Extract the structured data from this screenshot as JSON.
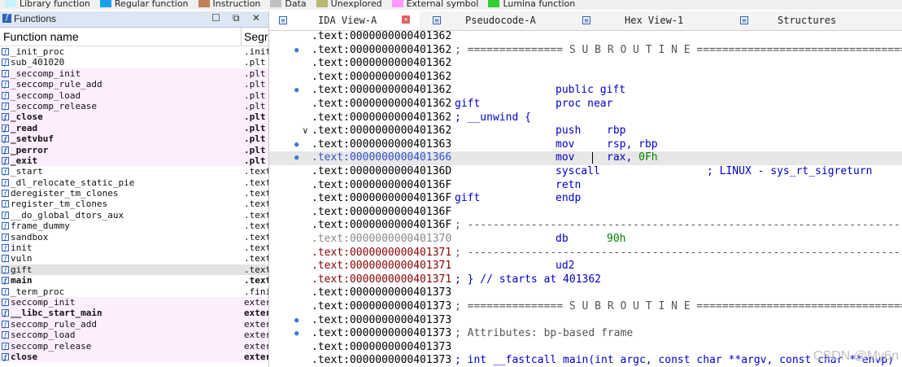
{
  "legend": [
    {
      "label": "Library function",
      "color": "#c8f2ff"
    },
    {
      "label": "Regular function",
      "color": "#1aa0ef"
    },
    {
      "label": "Instruction",
      "color": "#c0805a"
    },
    {
      "label": "Data",
      "color": "#c0c0c0"
    },
    {
      "label": "Unexplored",
      "color": "#b8b870"
    },
    {
      "label": "External symbol",
      "color": "#ff99ff"
    },
    {
      "label": "Lumina function",
      "color": "#33cc33"
    }
  ],
  "functions_panel": {
    "title": "Functions",
    "buttons": "☐ ⧉ ✕",
    "col_name": "Function name",
    "col_segment": "Segr",
    "rows": [
      {
        "name": "_init_proc",
        "seg": ".init",
        "style": ""
      },
      {
        "name": "sub_401020",
        "seg": ".plt",
        "style": ""
      },
      {
        "name": "_seccomp_init",
        "seg": ".plt",
        "style": "lib"
      },
      {
        "name": "_seccomp_rule_add",
        "seg": ".plt",
        "style": "lib"
      },
      {
        "name": "_seccomp_load",
        "seg": ".plt",
        "style": "lib"
      },
      {
        "name": "_seccomp_release",
        "seg": ".plt",
        "style": "lib"
      },
      {
        "name": "_close",
        "seg": ".plt",
        "style": "lib bold"
      },
      {
        "name": "_read",
        "seg": ".plt",
        "style": "lib bold"
      },
      {
        "name": "_setvbuf",
        "seg": ".plt",
        "style": "lib bold"
      },
      {
        "name": "_perror",
        "seg": ".plt",
        "style": "lib bold"
      },
      {
        "name": "_exit",
        "seg": ".plt",
        "style": "lib bold"
      },
      {
        "name": "_start",
        "seg": ".text",
        "style": ""
      },
      {
        "name": "_dl_relocate_static_pie",
        "seg": ".text",
        "style": ""
      },
      {
        "name": "deregister_tm_clones",
        "seg": ".text",
        "style": ""
      },
      {
        "name": "register_tm_clones",
        "seg": ".text",
        "style": ""
      },
      {
        "name": "__do_global_dtors_aux",
        "seg": ".text",
        "style": ""
      },
      {
        "name": "frame_dummy",
        "seg": ".text",
        "style": ""
      },
      {
        "name": "sandbox",
        "seg": ".text",
        "style": ""
      },
      {
        "name": "init",
        "seg": ".text",
        "style": ""
      },
      {
        "name": "vuln",
        "seg": ".text",
        "style": ""
      },
      {
        "name": "gift",
        "seg": ".text",
        "style": "sel"
      },
      {
        "name": "main",
        "seg": ".text",
        "style": "bold"
      },
      {
        "name": "_term_proc",
        "seg": ".fini",
        "style": ""
      },
      {
        "name": "seccomp_init",
        "seg": "exter",
        "style": "lib"
      },
      {
        "name": "__libc_start_main",
        "seg": "exter",
        "style": "lib bold"
      },
      {
        "name": "seccomp_rule_add",
        "seg": "exter",
        "style": "lib"
      },
      {
        "name": "seccomp_load",
        "seg": "exter",
        "style": "lib"
      },
      {
        "name": "seccomp_release",
        "seg": "exter",
        "style": "lib"
      },
      {
        "name": "close",
        "seg": "exter",
        "style": "lib bold"
      }
    ]
  },
  "tabs": [
    {
      "label": "IDA View-A",
      "active": true
    },
    {
      "label": "Pseudocode-A",
      "active": false
    },
    {
      "label": "Hex View-1",
      "active": false
    },
    {
      "label": "Structures",
      "active": false
    }
  ],
  "disasm": [
    {
      "addr": ".text:0000000000401362",
      "addr_style": "",
      "dot": false
    },
    {
      "addr": ".text:0000000000401362",
      "addr_style": "",
      "dot": true,
      "cmt_line": "; =============== S U B R O U T I N E ======================================="
    },
    {
      "addr": ".text:0000000000401362",
      "addr_style": "",
      "dot": false
    },
    {
      "addr": ".text:0000000000401362",
      "addr_style": "",
      "dot": false
    },
    {
      "addr": ".text:0000000000401362",
      "addr_style": "",
      "dot": true,
      "mnem": "public gift"
    },
    {
      "addr": ".text:0000000000401362",
      "addr_style": "",
      "dot": false,
      "label": "gift",
      "mnem": "proc near"
    },
    {
      "addr": ".text:0000000000401362",
      "addr_style": "",
      "dot": false,
      "label": "; __unwind {"
    },
    {
      "addr": ".text:0000000000401362",
      "addr_style": "",
      "dot": false,
      "chev": "∨",
      "mnem": "push",
      "op": "rbp"
    },
    {
      "addr": ".text:0000000000401363",
      "addr_style": "",
      "dot": true,
      "mnem": "mov",
      "op": "rsp, rbp"
    },
    {
      "addr": ".text:0000000000401366",
      "addr_style": "blue",
      "dot": true,
      "hl": true,
      "mnem": "mov",
      "op": "rax, ",
      "num": "0Fh",
      "cursor": true
    },
    {
      "addr": ".text:000000000040136D",
      "addr_style": "",
      "dot": false,
      "mnem": "syscall",
      "cmt_right": "; LINUX - sys_rt_sigreturn"
    },
    {
      "addr": ".text:000000000040136F",
      "addr_style": "",
      "dot": false,
      "mnem": "retn"
    },
    {
      "addr": ".text:000000000040136F",
      "addr_style": "",
      "dot": false,
      "label": "gift",
      "mnem": "endp"
    },
    {
      "addr": ".text:000000000040136F",
      "addr_style": "",
      "dot": false
    },
    {
      "addr": ".text:000000000040136F",
      "addr_style": "",
      "dot": false,
      "cmt_line": "; ---------------------------------------------------------------------------"
    },
    {
      "addr": ".text:0000000000401370",
      "addr_style": "grey",
      "dot": false,
      "mnem": "db",
      "op": "",
      "num": "90h"
    },
    {
      "addr": ".text:0000000000401371",
      "addr_style": "red",
      "dot": false,
      "cmt_line": "; ---------------------------------------------------------------------------"
    },
    {
      "addr": ".text:0000000000401371",
      "addr_style": "red",
      "dot": false,
      "mnem": "ud2"
    },
    {
      "addr": ".text:0000000000401371",
      "addr_style": "red",
      "dot": false,
      "label": "; } // starts at 401362"
    },
    {
      "addr": ".text:0000000000401373",
      "addr_style": "",
      "dot": false
    },
    {
      "addr": ".text:0000000000401373",
      "addr_style": "",
      "dot": false,
      "cmt_line": "; =============== S U B R O U T I N E ======================================="
    },
    {
      "addr": ".text:0000000000401373",
      "addr_style": "",
      "dot": true
    },
    {
      "addr": ".text:0000000000401373",
      "addr_style": "",
      "dot": true,
      "cmt_line": "; Attributes: bp-based frame"
    },
    {
      "addr": ".text:0000000000401373",
      "addr_style": "",
      "dot": false
    },
    {
      "addr": ".text:0000000000401373",
      "addr_style": "",
      "dot": false,
      "label": "; int __fastcall main(int argc, const char **argv, const char **envp)"
    }
  ],
  "watermark": "CSDN @My6n"
}
